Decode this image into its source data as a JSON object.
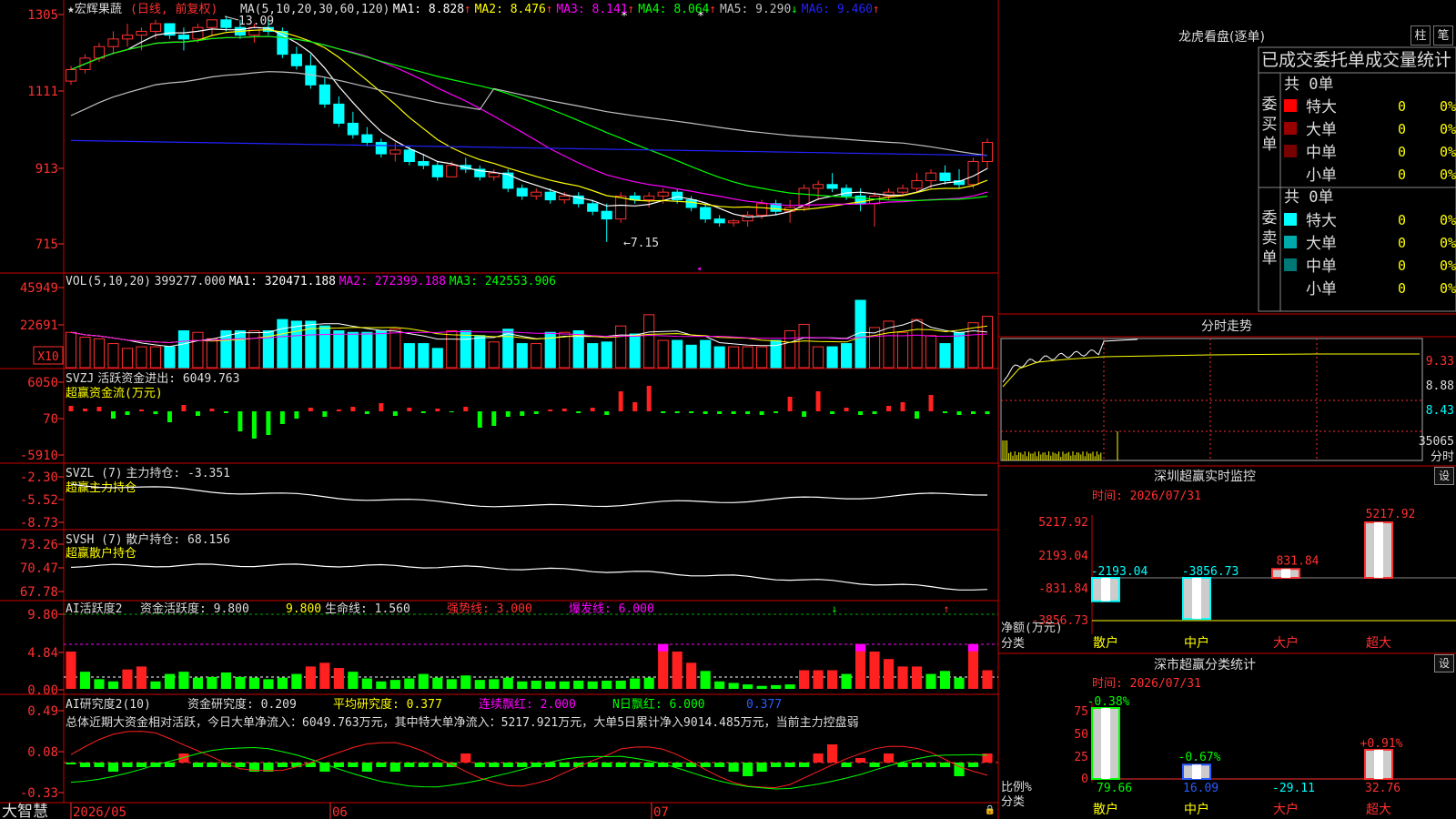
{
  "stock": {
    "title": "★宏辉果蔬",
    "mode": "(日线, 前复权)",
    "ma_header": "MA(5,10,20,30,60,120)",
    "ma": [
      {
        "label": "MA1: 8.828",
        "arrow": "↑",
        "color": "#ffffff"
      },
      {
        "label": "MA2: 8.476",
        "arrow": "↑",
        "color": "#ffff00"
      },
      {
        "label": "MA3: 8.141",
        "arrow": "↑",
        "color": "#ff00ff"
      },
      {
        "label": "MA4: 8.064",
        "arrow": "↑",
        "color": "#00ff00"
      },
      {
        "label": "MA5: 9.290",
        "arrow": "↓",
        "color": "#c0c0c0"
      },
      {
        "label": "MA6: 9.460",
        "arrow": "↑",
        "color": "#2222ff"
      }
    ],
    "high_marker": "13.09",
    "low_marker": "←7.15"
  },
  "axes": {
    "price": [
      "1305",
      "1111",
      "913",
      "715"
    ],
    "volume": [
      "45949",
      "22691"
    ],
    "vol_unit": "X10",
    "svzj": [
      "6050",
      "70",
      "-5910"
    ],
    "svzl": [
      "-2.30",
      "-5.52",
      "-8.73"
    ],
    "svsh": [
      "73.26",
      "70.47",
      "67.78"
    ],
    "ai1": [
      "9.80",
      "4.84",
      "0.00"
    ],
    "ai2": [
      "0.49",
      "0.08",
      "-0.33"
    ],
    "dates": [
      "2026/05",
      "06",
      "07"
    ]
  },
  "panels": {
    "vol": {
      "name": "VOL(5,10,20)",
      "value": "399277.000",
      "ma1": "MA1: 320471.188",
      "ma2": "MA2: 272399.188",
      "ma3": "MA3: 242553.906"
    },
    "svzj": {
      "name": "SVZJ",
      "label": "活跃资金进出: 6049.763",
      "sub": "超赢资金流(万元)"
    },
    "svzl": {
      "name": "SVZL (7)",
      "label": "主力持仓: -3.351",
      "sub": "超赢主力持仓"
    },
    "svsh": {
      "name": "SVSH (7)",
      "label": "散户持仓: 68.156",
      "sub": "超赢散户持仓"
    },
    "ai1": {
      "name": "AI活跃度2",
      "a": "资金活跃度: 9.800",
      "b": "9.800",
      "c": "生命线: 1.560",
      "d": "强势线: 3.000",
      "e": "爆发线: 6.000"
    },
    "ai2": {
      "name": "AI研究度2(10)",
      "a": "资金研究度: 0.209",
      "b": "平均研究度: 0.377",
      "c": "连续飘红: 2.000",
      "d": "N日飘红: 6.000",
      "e": "0.377",
      "summary": "总体近期大资金相对活跃，今日大单净流入：6049.763万元，其中特大单净流入：5217.921万元，大单5日累计净入9014.485万元，当前主力控盘弱"
    }
  },
  "brand": "大智慧",
  "right": {
    "dragon_title": "龙虎看盘(逐单)",
    "btn_zhu": "柱",
    "btn_bi": "笔",
    "stats_title": "已成交委托单成交量统计",
    "buy_label": "委买单",
    "sell_label": "委卖单",
    "buy_total": "共 0单",
    "sell_total": "共 0单",
    "rows": [
      {
        "name": "特大",
        "count": "0",
        "pct": "0%"
      },
      {
        "name": "大单",
        "count": "0",
        "pct": "0%"
      },
      {
        "name": "中单",
        "count": "0",
        "pct": "0%"
      },
      {
        "name": "小单",
        "count": "0",
        "pct": "0%"
      }
    ],
    "buy_colors": [
      "#ff0000",
      "#990000",
      "#770000"
    ],
    "sell_colors": [
      "#00ffff",
      "#00aaaa",
      "#007777"
    ],
    "intraday_title": "分时走势",
    "intraday_axis": [
      "9.33",
      "8.88",
      "8.43"
    ],
    "intraday_vol": "35065",
    "intraday_unit": "分时",
    "monitor_title": "深圳超赢实时监控",
    "monitor_time": "时间: 2026/07/31",
    "monitor_axis": [
      "5217.92",
      "2193.04",
      "-831.84",
      "-3856.73"
    ],
    "monitor_unit": "净额(万元)",
    "monitor_cat": "分类",
    "categories": [
      "散户",
      "中户",
      "大户",
      "超大"
    ],
    "monitor_values": [
      "-2193.04",
      "-3856.73",
      "831.84",
      "5217.92"
    ],
    "monitor_data": [
      -2193.04,
      -3856.73,
      831.84,
      5217.92
    ],
    "class_title": "深市超赢分类统计",
    "class_time": "时间: 2026/07/31",
    "class_axis": [
      "75",
      "50",
      "25",
      "0"
    ],
    "class_pct": [
      "-0.38%",
      "-0.67%",
      "",
      "+0.91%"
    ],
    "class_values": [
      "79.66",
      "16.09",
      "-29.11",
      "32.76"
    ],
    "class_data": [
      79.66,
      16.09,
      -29.11,
      32.76
    ],
    "class_unit": "比例%",
    "class_cat": "分类",
    "set_label": "设"
  },
  "chart_data": {
    "type": "candlestick",
    "ohlc": [
      [
        11.4,
        11.8,
        11.3,
        11.7
      ],
      [
        11.7,
        12.1,
        11.6,
        12.0
      ],
      [
        12.0,
        12.4,
        11.9,
        12.3
      ],
      [
        12.3,
        12.7,
        12.1,
        12.5
      ],
      [
        12.5,
        12.9,
        12.3,
        12.6
      ],
      [
        12.6,
        12.8,
        12.2,
        12.7
      ],
      [
        12.7,
        13.0,
        12.5,
        12.9
      ],
      [
        12.9,
        12.9,
        12.5,
        12.6
      ],
      [
        12.6,
        12.8,
        12.2,
        12.5
      ],
      [
        12.5,
        12.9,
        12.4,
        12.8
      ],
      [
        12.8,
        13.0,
        12.6,
        13.0
      ],
      [
        13.0,
        13.1,
        12.7,
        12.8
      ],
      [
        12.8,
        13.0,
        12.5,
        12.6
      ],
      [
        12.6,
        12.9,
        12.4,
        12.8
      ],
      [
        12.8,
        13.0,
        12.6,
        12.7
      ],
      [
        12.7,
        12.8,
        12.0,
        12.1
      ],
      [
        12.1,
        12.3,
        11.7,
        11.8
      ],
      [
        11.8,
        12.1,
        11.2,
        11.3
      ],
      [
        11.3,
        11.5,
        10.7,
        10.8
      ],
      [
        10.8,
        11.0,
        10.2,
        10.3
      ],
      [
        10.3,
        10.6,
        9.9,
        10.0
      ],
      [
        10.0,
        10.2,
        9.7,
        9.8
      ],
      [
        9.8,
        9.9,
        9.4,
        9.5
      ],
      [
        9.5,
        9.8,
        9.3,
        9.6
      ],
      [
        9.6,
        9.7,
        9.2,
        9.3
      ],
      [
        9.3,
        9.5,
        9.1,
        9.2
      ],
      [
        9.2,
        9.3,
        8.8,
        8.9
      ],
      [
        8.9,
        9.3,
        8.9,
        9.2
      ],
      [
        9.2,
        9.4,
        9.0,
        9.1
      ],
      [
        9.1,
        9.2,
        8.8,
        8.9
      ],
      [
        8.9,
        9.1,
        8.8,
        9.0
      ],
      [
        9.0,
        9.1,
        8.5,
        8.6
      ],
      [
        8.6,
        8.7,
        8.3,
        8.4
      ],
      [
        8.4,
        8.6,
        8.3,
        8.5
      ],
      [
        8.5,
        8.6,
        8.2,
        8.3
      ],
      [
        8.3,
        8.5,
        8.2,
        8.4
      ],
      [
        8.4,
        8.5,
        8.1,
        8.2
      ],
      [
        8.2,
        8.3,
        7.9,
        8.0
      ],
      [
        8.0,
        8.2,
        7.2,
        7.8
      ],
      [
        7.8,
        8.5,
        7.7,
        8.4
      ],
      [
        8.4,
        8.5,
        8.2,
        8.3
      ],
      [
        8.3,
        8.5,
        8.1,
        8.4
      ],
      [
        8.4,
        8.6,
        8.2,
        8.5
      ],
      [
        8.5,
        8.6,
        8.2,
        8.3
      ],
      [
        8.3,
        8.4,
        8.0,
        8.1
      ],
      [
        8.1,
        8.2,
        7.7,
        7.8
      ],
      [
        7.8,
        7.9,
        7.6,
        7.7
      ],
      [
        7.7,
        7.8,
        7.6,
        7.75
      ],
      [
        7.75,
        8.0,
        7.6,
        7.9
      ],
      [
        7.9,
        8.3,
        7.8,
        8.2
      ],
      [
        8.2,
        8.3,
        7.9,
        8.0
      ],
      [
        8.0,
        8.3,
        7.7,
        8.1
      ],
      [
        8.1,
        8.7,
        8.0,
        8.6
      ],
      [
        8.6,
        8.8,
        8.3,
        8.7
      ],
      [
        8.7,
        9.0,
        8.5,
        8.6
      ],
      [
        8.6,
        8.7,
        8.3,
        8.4
      ],
      [
        8.4,
        8.6,
        8.0,
        8.2
      ],
      [
        8.2,
        8.5,
        7.6,
        8.4
      ],
      [
        8.4,
        8.6,
        8.3,
        8.5
      ],
      [
        8.5,
        8.7,
        8.4,
        8.6
      ],
      [
        8.6,
        9.0,
        8.5,
        8.8
      ],
      [
        8.8,
        9.1,
        8.6,
        9.0
      ],
      [
        9.0,
        9.2,
        8.7,
        8.8
      ],
      [
        8.8,
        9.1,
        8.6,
        8.7
      ],
      [
        8.7,
        9.4,
        8.6,
        9.3
      ],
      [
        9.3,
        9.9,
        9.1,
        9.8
      ]
    ],
    "volume": [
      2200,
      1900,
      1800,
      1500,
      1200,
      1300,
      1300,
      1300,
      2300,
      2200,
      1800,
      2300,
      2300,
      2300,
      2300,
      3000,
      2900,
      2900,
      2600,
      2300,
      2200,
      2200,
      2300,
      2400,
      1500,
      1500,
      1200,
      2300,
      2300,
      2000,
      1600,
      2400,
      1500,
      1500,
      2200,
      2200,
      2300,
      1500,
      1600,
      2600,
      2100,
      3300,
      1700,
      1700,
      1400,
      1700,
      1300,
      1300,
      1300,
      1300,
      1700,
      2300,
      2700,
      1300,
      1300,
      1500,
      4200,
      2500,
      2900,
      2200,
      3000,
      2000,
      1500,
      2200,
      2800,
      2600,
      2000,
      1700,
      2100,
      3200
    ],
    "volume_ylim": [
      0,
      45949
    ],
    "price_ylim": [
      7.15,
      13.09
    ]
  }
}
